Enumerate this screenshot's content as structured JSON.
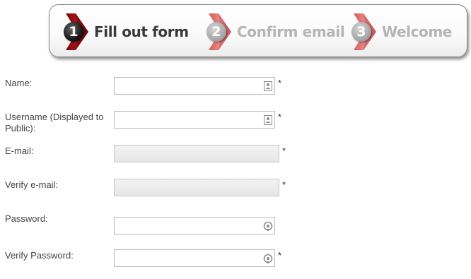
{
  "steps": [
    {
      "number": "1",
      "label": "Fill out form",
      "state": "active"
    },
    {
      "number": "2",
      "label": "Confirm email",
      "state": "inactive"
    },
    {
      "number": "3",
      "label": "Welcome",
      "state": "inactive"
    }
  ],
  "colors": {
    "arrow_active": "#9b0f14",
    "arrow_inactive": "#e27a7a",
    "text_active": "#3a3a3a",
    "text_inactive": "#b4b4b4"
  },
  "form": {
    "required_marker": "*",
    "name": {
      "label": "Name:",
      "value": "",
      "icon": "contact-card-icon"
    },
    "username": {
      "label": "Username (Displayed to Public):",
      "value": "",
      "icon": "contact-card-icon"
    },
    "email": {
      "label": "E-mail:",
      "value": ""
    },
    "verify_email": {
      "label": "Verify e-mail:",
      "value": ""
    },
    "password": {
      "label": "Password:",
      "value": "",
      "icon": "password-key-icon"
    },
    "verify_password": {
      "label": "Verify Password:",
      "value": "",
      "icon": "password-key-icon"
    }
  }
}
